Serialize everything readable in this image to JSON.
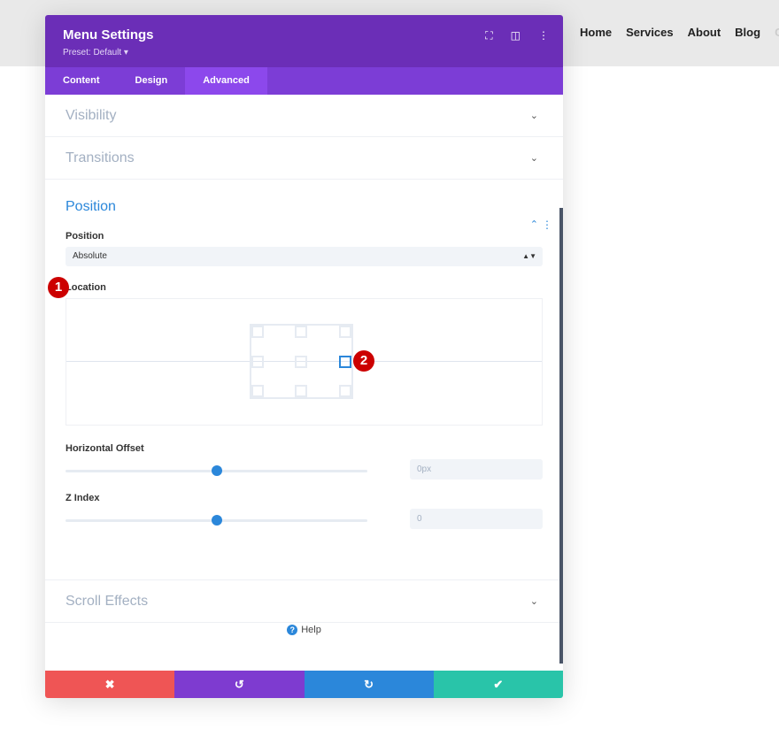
{
  "nav": {
    "items": [
      "Home",
      "Services",
      "About",
      "Blog",
      "C"
    ]
  },
  "modal": {
    "title": "Menu Settings",
    "preset": "Preset: Default ▾",
    "tabs": [
      "Content",
      "Design",
      "Advanced"
    ],
    "active_tab": "Advanced"
  },
  "sections": {
    "visibility": "Visibility",
    "transitions": "Transitions",
    "position": "Position",
    "scroll_effects": "Scroll Effects"
  },
  "position": {
    "position_label": "Position",
    "position_value": "Absolute",
    "location_label": "Location",
    "location_selected": "right-center",
    "horizontal_offset_label": "Horizontal Offset",
    "horizontal_offset_value": "0px",
    "horizontal_offset_slider": 0.5,
    "z_index_label": "Z Index",
    "z_index_value": "0",
    "z_index_slider": 0.5
  },
  "annotations": [
    "1",
    "2"
  ],
  "help": "Help",
  "footer": {
    "cancel": "✖",
    "undo": "↺",
    "redo": "↻",
    "save": "✔"
  },
  "colors": {
    "header": "#6b2eb7",
    "tabs": "#7c3dd6",
    "accent": "#2b87da",
    "cancel": "#ef5555",
    "undo": "#7e3bd0",
    "redo": "#2b87da",
    "save": "#29c4a9"
  }
}
